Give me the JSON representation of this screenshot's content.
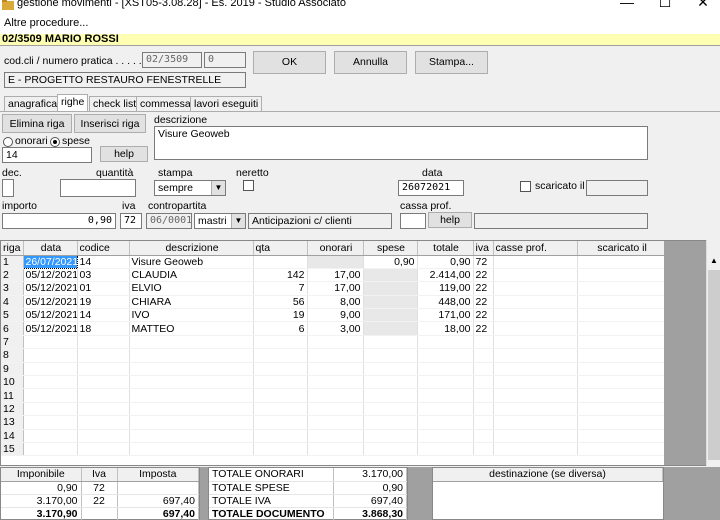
{
  "window": {
    "title": "gestione movimenti - [XST05-3.08.28] - Es. 2019 - Studio Associato",
    "minimize": "—",
    "maximize": "☐",
    "close": "✕"
  },
  "menu": {
    "item": "Altre procedure..."
  },
  "header": {
    "client": "02/3509 MARIO ROSSI"
  },
  "form": {
    "codcli_label": "cod.cli / numero pratica . . . . . . . . . .",
    "codcli_value": "02/3509",
    "pratica_value": "0",
    "project": "E - PROGETTO RESTAURO FENESTRELLE",
    "ok": "OK",
    "annulla": "Annulla",
    "stampa": "Stampa..."
  },
  "tabs": [
    "anagrafica",
    "righe",
    "check list",
    "commessa",
    "lavori eseguiti"
  ],
  "editor": {
    "elimina": "Elimina riga",
    "inserisci": "Inserisci riga",
    "descrizione_label": "descrizione",
    "descrizione_value": "Visure Geoweb",
    "onorari": "onorari",
    "spese": "spese",
    "code_value": "14",
    "help": "help",
    "dec_label": "dec.",
    "quantita_label": "quantità",
    "stampa_label": "stampa",
    "stampa_value": "sempre",
    "neretto_label": "neretto",
    "data_label": "data",
    "data_value": "26072021",
    "scaricato_label": "scaricato il",
    "importo_label": "importo",
    "importo_value": "0,90",
    "iva_label": "iva",
    "iva_value": "72",
    "contropartita_label": "contropartita",
    "contropartita_value": "06/0001",
    "mastri_value": "mastri",
    "contropartita_desc": "Anticipazioni c/ clienti",
    "cassa_label": "cassa prof.",
    "help2": "help"
  },
  "grid": {
    "columns": [
      "riga",
      "data",
      "codice",
      "descrizione",
      "qta",
      "onorari",
      "spese",
      "totale",
      "iva",
      "casse prof.",
      "scaricato il"
    ],
    "rows": [
      [
        "1",
        "26/07/2021",
        "14",
        "Visure Geoweb",
        "",
        "",
        "0,90",
        "0,90",
        "72",
        "",
        ""
      ],
      [
        "2",
        "05/12/2021",
        "03",
        "CLAUDIA",
        "142",
        "17,00",
        "",
        "2.414,00",
        "22",
        "",
        ""
      ],
      [
        "3",
        "05/12/2021",
        "01",
        "ELVIO",
        "7",
        "17,00",
        "",
        "119,00",
        "22",
        "",
        ""
      ],
      [
        "4",
        "05/12/2021",
        "19",
        "CHIARA",
        "56",
        "8,00",
        "",
        "448,00",
        "22",
        "",
        ""
      ],
      [
        "5",
        "05/12/2021",
        "14",
        "IVO",
        "19",
        "9,00",
        "",
        "171,00",
        "22",
        "",
        ""
      ],
      [
        "6",
        "05/12/2021",
        "18",
        "MATTEO",
        "6",
        "3,00",
        "",
        "18,00",
        "22",
        "",
        ""
      ],
      [
        "7",
        "",
        "",
        "",
        "",
        "",
        "",
        "",
        "",
        "",
        ""
      ],
      [
        "8",
        "",
        "",
        "",
        "",
        "",
        "",
        "",
        "",
        "",
        ""
      ],
      [
        "9",
        "",
        "",
        "",
        "",
        "",
        "",
        "",
        "",
        "",
        ""
      ],
      [
        "10",
        "",
        "",
        "",
        "",
        "",
        "",
        "",
        "",
        "",
        ""
      ],
      [
        "11",
        "",
        "",
        "",
        "",
        "",
        "",
        "",
        "",
        "",
        ""
      ],
      [
        "12",
        "",
        "",
        "",
        "",
        "",
        "",
        "",
        "",
        "",
        ""
      ],
      [
        "13",
        "",
        "",
        "",
        "",
        "",
        "",
        "",
        "",
        "",
        ""
      ],
      [
        "14",
        "",
        "",
        "",
        "",
        "",
        "",
        "",
        "",
        "",
        ""
      ],
      [
        "15",
        "",
        "",
        "",
        "",
        "",
        "",
        "",
        "",
        "",
        ""
      ]
    ]
  },
  "iva_summary": {
    "headers": [
      "Imponibile",
      "Iva",
      "Imposta"
    ],
    "rows": [
      [
        "0,90",
        "72",
        ""
      ],
      [
        "3.170,00",
        "22",
        "697,40"
      ],
      [
        "3.170,90",
        "",
        "697,40"
      ]
    ]
  },
  "totals": {
    "rows": [
      [
        "TOTALE ONORARI",
        "3.170,00"
      ],
      [
        "TOTALE SPESE",
        "0,90"
      ],
      [
        "TOTALE IVA",
        "697,40"
      ],
      [
        "TOTALE DOCUMENTO",
        "3.868,30"
      ]
    ]
  },
  "destinazione": {
    "header": "destinazione (se diversa)"
  }
}
